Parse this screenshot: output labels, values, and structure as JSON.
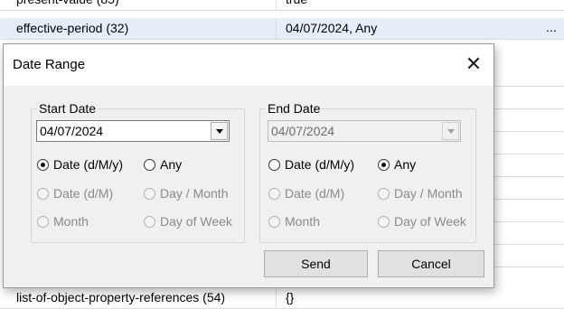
{
  "grid": {
    "rows": [
      {
        "name": "present-value (85)",
        "value": "true",
        "more": ""
      },
      {
        "name": "effective-period (32)",
        "value": "04/07/2024, Any",
        "more": "..."
      },
      {
        "name": "list-of-object-property-references (54)",
        "value": "{}",
        "more": ""
      }
    ]
  },
  "dialog": {
    "title": "Date Range",
    "start": {
      "legend": "Start Date",
      "date_value": "04/07/2024",
      "options": {
        "date_dmy": "Date (d/M/y)",
        "any": "Any",
        "date_dm": "Date (d/M)",
        "day_month": "Day / Month",
        "month": "Month",
        "day_of_week": "Day of Week"
      }
    },
    "end": {
      "legend": "End Date",
      "date_value": "04/07/2024",
      "options": {
        "date_dmy": "Date (d/M/y)",
        "any": "Any",
        "date_dm": "Date (d/M)",
        "day_month": "Day / Month",
        "month": "Month",
        "day_of_week": "Day of Week"
      }
    },
    "send_label": "Send",
    "cancel_label": "Cancel",
    "close_glyph": "✕"
  }
}
